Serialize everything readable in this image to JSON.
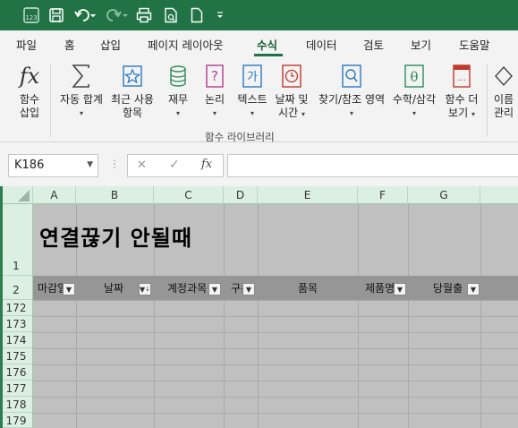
{
  "qat": {
    "autosave_badge": "123",
    "customize_label": "☰"
  },
  "tabs": [
    "파일",
    "홈",
    "삽입",
    "페이지 레이아웃",
    "수식",
    "데이터",
    "검토",
    "보기",
    "도움말"
  ],
  "ribbon": {
    "insert_fn": {
      "line1": "함수",
      "line2": "삽입",
      "icon": "fx"
    },
    "autosum": {
      "line1": "자동 합계",
      "icon": "sigma-icon"
    },
    "recent": {
      "line1": "최근 사용",
      "line2": "항목",
      "icon": "star-icon"
    },
    "financial": {
      "line1": "재무",
      "icon": "coins-icon"
    },
    "logical": {
      "line1": "논리",
      "icon": "question-icon"
    },
    "text": {
      "line1": "텍스트",
      "icon": "ga",
      "glyph": "가"
    },
    "datetime": {
      "line1": "날짜 및",
      "line2": "시간",
      "icon": "clock-icon"
    },
    "lookup": {
      "line1": "찾기/참조",
      "icon": "magnifier-icon"
    },
    "area": {
      "line1": "영역"
    },
    "mathtrig": {
      "line1": "수학/삼각",
      "icon": "theta-icon",
      "glyph": "θ"
    },
    "more": {
      "line1": "함수 더",
      "line2": "보기",
      "icon": "book-icon",
      "glyph": "..."
    },
    "name_mgr": {
      "line1": "이름",
      "line2": "관리"
    },
    "group_label": "함수 라이브러리"
  },
  "formula_bar": {
    "name_box": "K186",
    "cancel_glyph": "✕",
    "enter_glyph": "✓",
    "fx_glyph": "fx",
    "formula": ""
  },
  "sheet": {
    "columns": [
      "A",
      "B",
      "C",
      "D",
      "E",
      "F",
      "G"
    ],
    "rows": [
      "1",
      "2",
      "172",
      "173",
      "174",
      "175",
      "176",
      "177",
      "178",
      "179"
    ],
    "title": "연결끊기 안될때",
    "headers": [
      "마감일",
      "날짜",
      "계정과목",
      "구분",
      "품목",
      "제품명",
      "당월출"
    ],
    "sort_marker": "↓"
  }
}
